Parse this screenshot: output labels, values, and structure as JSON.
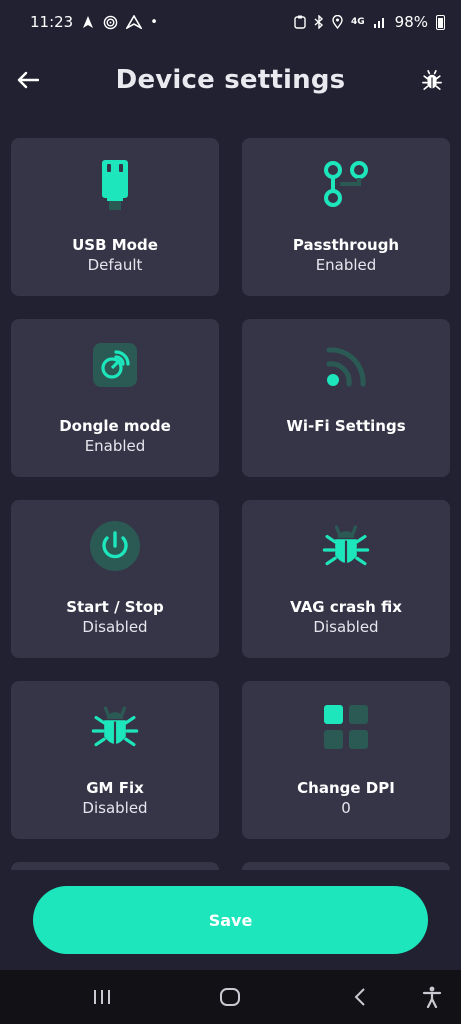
{
  "status_bar": {
    "time": "11:23",
    "network": "4G",
    "battery": "98%",
    "left_icons": [
      "navigation-icon",
      "podcast-icon",
      "android-auto-icon",
      "dot-icon"
    ],
    "right_icons": [
      "nfc-icon",
      "bluetooth-icon",
      "location-icon",
      "network-icon",
      "signal-icon",
      "battery-icon"
    ]
  },
  "header": {
    "title": "Device settings",
    "back_icon": "arrow-left-icon",
    "debug_icon": "bug-icon"
  },
  "colors": {
    "accent": "#1de6bc",
    "background": "#222131",
    "card": "#363547",
    "icon_bg": "#2b5a55"
  },
  "cards": [
    {
      "label": "USB Mode",
      "value": "Default",
      "icon": "usb-icon"
    },
    {
      "label": "Passthrough",
      "value": "Enabled",
      "icon": "passthrough-icon"
    },
    {
      "label": "Dongle mode",
      "value": "Enabled",
      "icon": "dongle-icon"
    },
    {
      "label": "Wi-Fi Settings",
      "value": "",
      "icon": "wifi-icon"
    },
    {
      "label": "Start / Stop",
      "value": "Disabled",
      "icon": "power-icon"
    },
    {
      "label": "VAG crash fix",
      "value": "Disabled",
      "icon": "bug-icon"
    },
    {
      "label": "GM Fix",
      "value": "Disabled",
      "icon": "bug-icon"
    },
    {
      "label": "Change DPI",
      "value": "0",
      "icon": "grid-icon"
    }
  ],
  "save": {
    "label": "Save"
  },
  "nav": {
    "icons": [
      "recents-icon",
      "home-icon",
      "back-icon",
      "accessibility-icon"
    ]
  }
}
